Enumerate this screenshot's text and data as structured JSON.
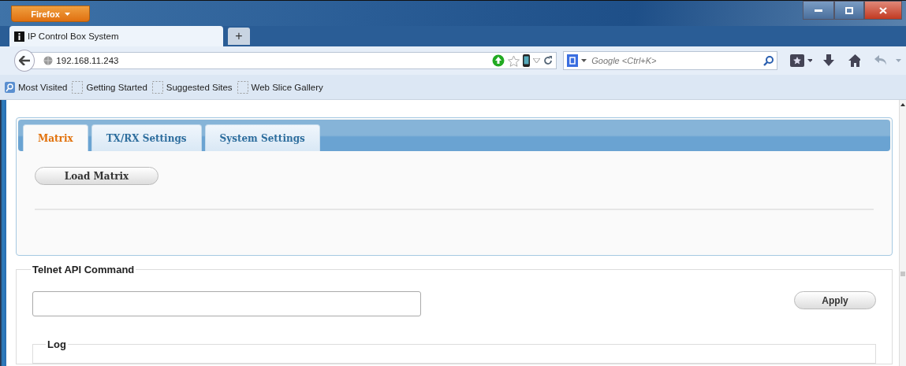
{
  "browser": {
    "menu_button": "Firefox",
    "tabs": [
      {
        "title": "IP Control Box System",
        "selected": true
      }
    ],
    "new_tab": "+",
    "address": "192.168.11.243",
    "search": {
      "placeholder": "Google <Ctrl+K>"
    },
    "bookmarks": [
      {
        "label": "Most Visited",
        "kind": "folder"
      },
      {
        "label": "Getting Started",
        "kind": "page"
      },
      {
        "label": "Suggested Sites",
        "kind": "page"
      },
      {
        "label": "Web Slice Gallery",
        "kind": "page"
      }
    ]
  },
  "page": {
    "tabs": [
      {
        "label": "Matrix",
        "selected": true
      },
      {
        "label": "TX/RX Settings",
        "selected": false
      },
      {
        "label": "System Settings",
        "selected": false
      }
    ],
    "load_button": "Load Matrix",
    "telnet": {
      "legend": "Telnet API Command",
      "button": "Apply"
    },
    "log": {
      "legend": "Log"
    }
  }
}
